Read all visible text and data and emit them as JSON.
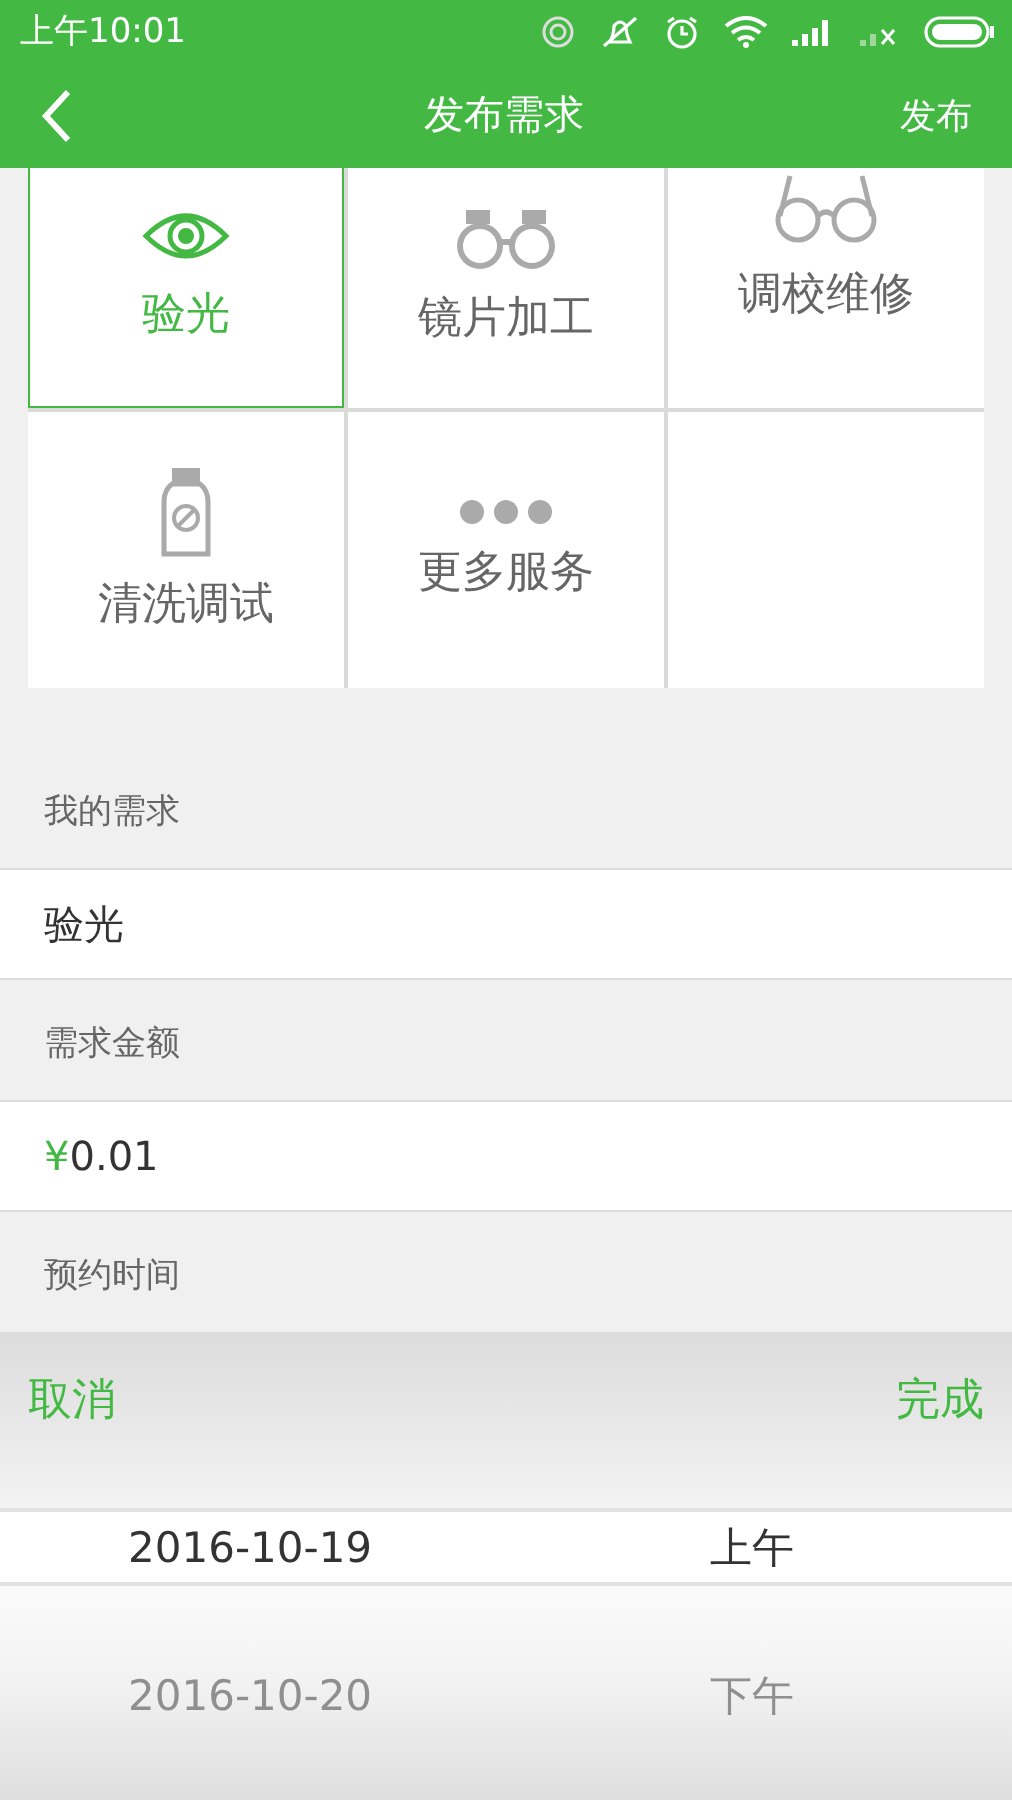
{
  "status_bar": {
    "time": "上午10:01"
  },
  "nav": {
    "title": "发布需求",
    "action": "发布"
  },
  "services": [
    {
      "kind": "eye",
      "label": "验光",
      "selected": true
    },
    {
      "kind": "goggles",
      "label": "镜片加工",
      "selected": false
    },
    {
      "kind": "glasses",
      "label": "调校维修",
      "selected": false
    },
    {
      "kind": "bottle",
      "label": "清洗调试",
      "selected": false
    },
    {
      "kind": "dots",
      "label": "更多服务",
      "selected": false
    }
  ],
  "form": [
    {
      "label": "我的需求",
      "value": "验光"
    },
    {
      "label": "需求金额",
      "currency": "¥",
      "value": "0.01"
    },
    {
      "label": "预约时间"
    }
  ],
  "picker": {
    "cancel": "取消",
    "done": "完成",
    "rows": [
      {
        "date": "2016-10-19",
        "period": "上午",
        "selected": true
      },
      {
        "date": "2016-10-20",
        "period": "下午",
        "selected": false
      }
    ]
  }
}
